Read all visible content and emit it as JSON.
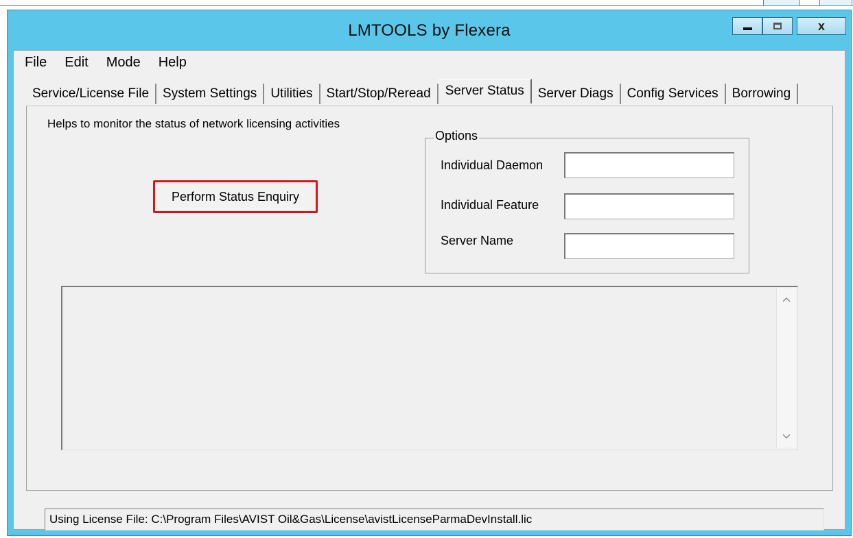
{
  "window": {
    "title": "LMTOOLS by Flexera",
    "minimize_label": "minimize",
    "maximize_label": "maximize",
    "close_glyph": "x"
  },
  "menu": [
    "File",
    "Edit",
    "Mode",
    "Help"
  ],
  "tabs": [
    {
      "label": "Service/License File",
      "active": false
    },
    {
      "label": "System Settings",
      "active": false
    },
    {
      "label": "Utilities",
      "active": false
    },
    {
      "label": "Start/Stop/Reread",
      "active": false
    },
    {
      "label": "Server Status",
      "active": true
    },
    {
      "label": "Server Diags",
      "active": false
    },
    {
      "label": "Config Services",
      "active": false
    },
    {
      "label": "Borrowing",
      "active": false
    }
  ],
  "panel": {
    "help_text": "Helps to monitor the status of network licensing activities",
    "status_button": "Perform Status Enquiry",
    "options": {
      "legend": "Options",
      "individual_daemon_label": "Individual Daemon",
      "individual_daemon_value": "",
      "individual_feature_label": "Individual Feature",
      "individual_feature_value": "",
      "server_name_label": "Server Name",
      "server_name_value": ""
    },
    "output_text": ""
  },
  "statusbar": {
    "text": "Using License File:  C:\\Program Files\\AVIST Oil&Gas\\License\\avistLicenseParmaDevInstall.lic"
  },
  "colors": {
    "titlebar": "#5ac7ea",
    "highlight_border": "#d4151c",
    "client_bg": "#f0f0f0"
  },
  "icons": {
    "minimize": "minimize-icon",
    "maximize": "maximize-icon",
    "close": "close-icon",
    "scroll_up": "chevron-up-icon",
    "scroll_down": "chevron-down-icon"
  }
}
